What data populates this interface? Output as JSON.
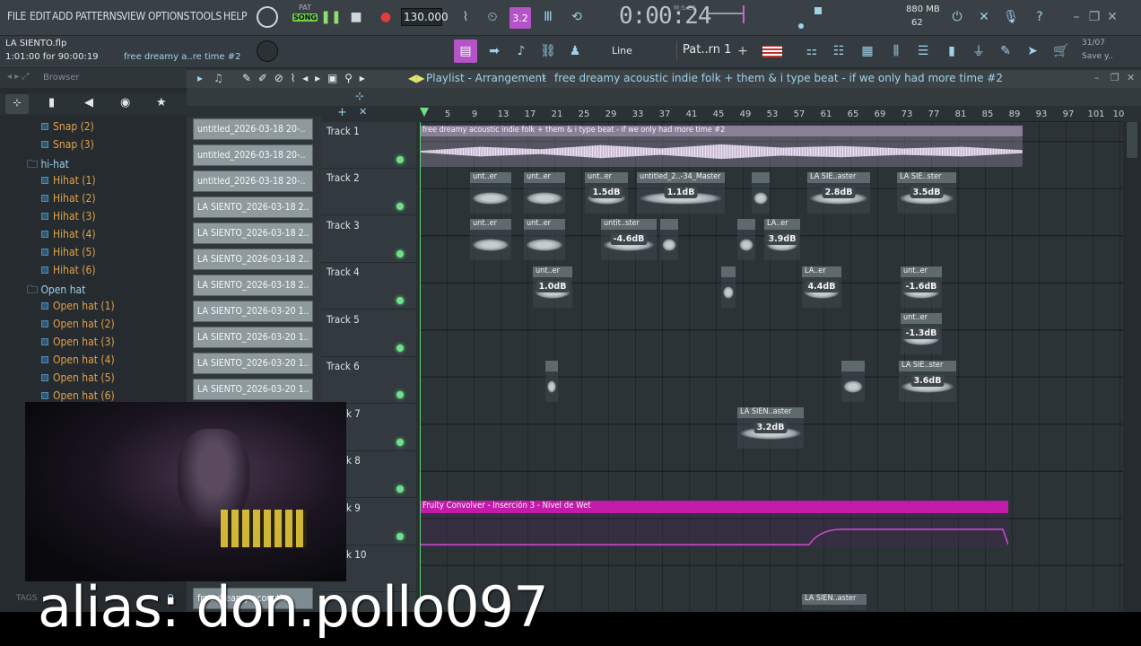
{
  "menu": [
    "FILE",
    "EDIT",
    "ADD",
    "PATTERNS",
    "VIEW",
    "OPTIONS",
    "TOOLS",
    "HELP"
  ],
  "transport": {
    "pat": "PAT",
    "song": "SONG",
    "tempo": "130.000",
    "time": "0:00:24",
    "time_label": "M:S:CS"
  },
  "memory": {
    "ram": "880 MB",
    "cpu": "62"
  },
  "project": {
    "file": "LA SIENTO.flp",
    "position": "1:01:00 for 90:00:19",
    "hint": "free dreamy a..re time #2"
  },
  "snap": {
    "mode": "Line",
    "pattern": "Pat..rn 1"
  },
  "date": {
    "value": "31/07",
    "label": "Save y.."
  },
  "browser": {
    "title": "Browser",
    "items": [
      {
        "label": "Snap (2)",
        "type": "file"
      },
      {
        "label": "Snap (3)",
        "type": "file"
      },
      {
        "label": "hi-hat",
        "type": "folder"
      },
      {
        "label": "Hihat (1)",
        "type": "file"
      },
      {
        "label": "Hihat (2)",
        "type": "file"
      },
      {
        "label": "Hihat (3)",
        "type": "file"
      },
      {
        "label": "Hihat (4)",
        "type": "file"
      },
      {
        "label": "Hihat (5)",
        "type": "file"
      },
      {
        "label": "Hihat (6)",
        "type": "file"
      },
      {
        "label": "Open hat",
        "type": "folder"
      },
      {
        "label": "Open hat (1)",
        "type": "file"
      },
      {
        "label": "Open hat (2)",
        "type": "file"
      },
      {
        "label": "Open hat (3)",
        "type": "file"
      },
      {
        "label": "Open hat (4)",
        "type": "file"
      },
      {
        "label": "Open hat (5)",
        "type": "file"
      },
      {
        "label": "Open hat (6)",
        "type": "file"
      }
    ],
    "tags_label": "TAGS"
  },
  "picker": [
    "untitled_2026-03-18 20-..",
    "untitled_2026-03-18 20-..",
    "untitled_2026-03-18 20-..",
    "LA SIENTO_2026-03-18 2..",
    "LA SIENTO_2026-03-18 2..",
    "LA SIENTO_2026-03-18 2..",
    "LA SIENTO_2026-03-18 2..",
    "LA SIENTO_2026-03-20 1..",
    "LA SIENTO_2026-03-20 1..",
    "LA SIENTO_2026-03-20 1..",
    "LA SIENTO_2026-03-20 1.."
  ],
  "picker_bottom": "free dreamy acoustic..",
  "playlist": {
    "title": "Playlist - Arrangement",
    "name": "free dreamy acoustic indie folk + them & i type beat - if we only had more time #2"
  },
  "ruler": [
    "5",
    "9",
    "13",
    "17",
    "21",
    "25",
    "29",
    "33",
    "37",
    "41",
    "45",
    "49",
    "53",
    "57",
    "61",
    "65",
    "69",
    "73",
    "77",
    "81",
    "85",
    "89",
    "93",
    "97",
    "101",
    "10"
  ],
  "tracks": [
    "Track 1",
    "Track 2",
    "Track 3",
    "Track 4",
    "Track 5",
    "Track 6",
    "k 7",
    "k 8",
    "k 9",
    "k 10"
  ],
  "clips": {
    "main": "free dreamy acoustic indie folk + them & i type beat - if we only had more time #2",
    "automation": "Fruity Convolver - Inserción 3 - Nivel de Wet",
    "t2": [
      {
        "label": "unt..er"
      },
      {
        "label": "unt..er"
      },
      {
        "label": "unt..er",
        "gain": "1.5dB"
      },
      {
        "label": "untitled_2..-34_Master",
        "gain": "1.1dB"
      },
      {
        "label": ""
      },
      {
        "label": "LA SIE..aster",
        "gain": "2.8dB"
      },
      {
        "label": "LA SIE..ster",
        "gain": "3.5dB"
      }
    ],
    "t3": [
      {
        "label": "unt..er"
      },
      {
        "label": "unt..er"
      },
      {
        "label": "untit..ster",
        "gain": "-4.6dB"
      },
      {
        "label": ""
      },
      {
        "label": ""
      },
      {
        "label": "LA..er",
        "gain": "3.9dB"
      }
    ],
    "t4": [
      {
        "label": "unt..er",
        "gain": "1.0dB"
      },
      {
        "label": ""
      },
      {
        "label": "LA..er",
        "gain": "4.4dB"
      },
      {
        "label": "unt..er",
        "gain": "-1.6dB"
      }
    ],
    "t5": [
      {
        "label": "unt..er",
        "gain": "-1.3dB"
      }
    ],
    "t6": [
      {
        "label": ""
      },
      {
        "label": ""
      },
      {
        "label": "LA SIE..ster",
        "gain": "3.6dB"
      }
    ],
    "t7": [
      {
        "label": "LA SIEN..aster",
        "gain": "3.2dB"
      }
    ],
    "t10": [
      {
        "label": "LA SIEN..aster"
      }
    ]
  },
  "overlay": {
    "alias": "alias: don.pollo097"
  }
}
